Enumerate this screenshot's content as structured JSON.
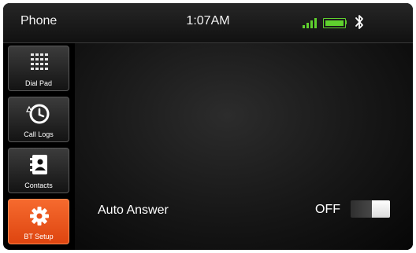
{
  "status_bar": {
    "app_title": "Phone",
    "time": "1:07AM",
    "signal_icon": "signal-bars-icon",
    "battery_icon": "battery-icon",
    "bluetooth_icon": "bluetooth-icon",
    "accent_color": "#5fd12e"
  },
  "sidebar": {
    "items": [
      {
        "label": "Dial Pad",
        "icon": "dial-pad-icon"
      },
      {
        "label": "Call Logs",
        "icon": "call-log-icon"
      },
      {
        "label": "Contacts",
        "icon": "contacts-icon"
      },
      {
        "label": "BT Setup",
        "icon": "gear-icon"
      }
    ],
    "active_index": 3,
    "active_color": "#f05a1e"
  },
  "settings": {
    "auto_answer_label": "Auto Answer",
    "auto_answer_state": "OFF"
  }
}
